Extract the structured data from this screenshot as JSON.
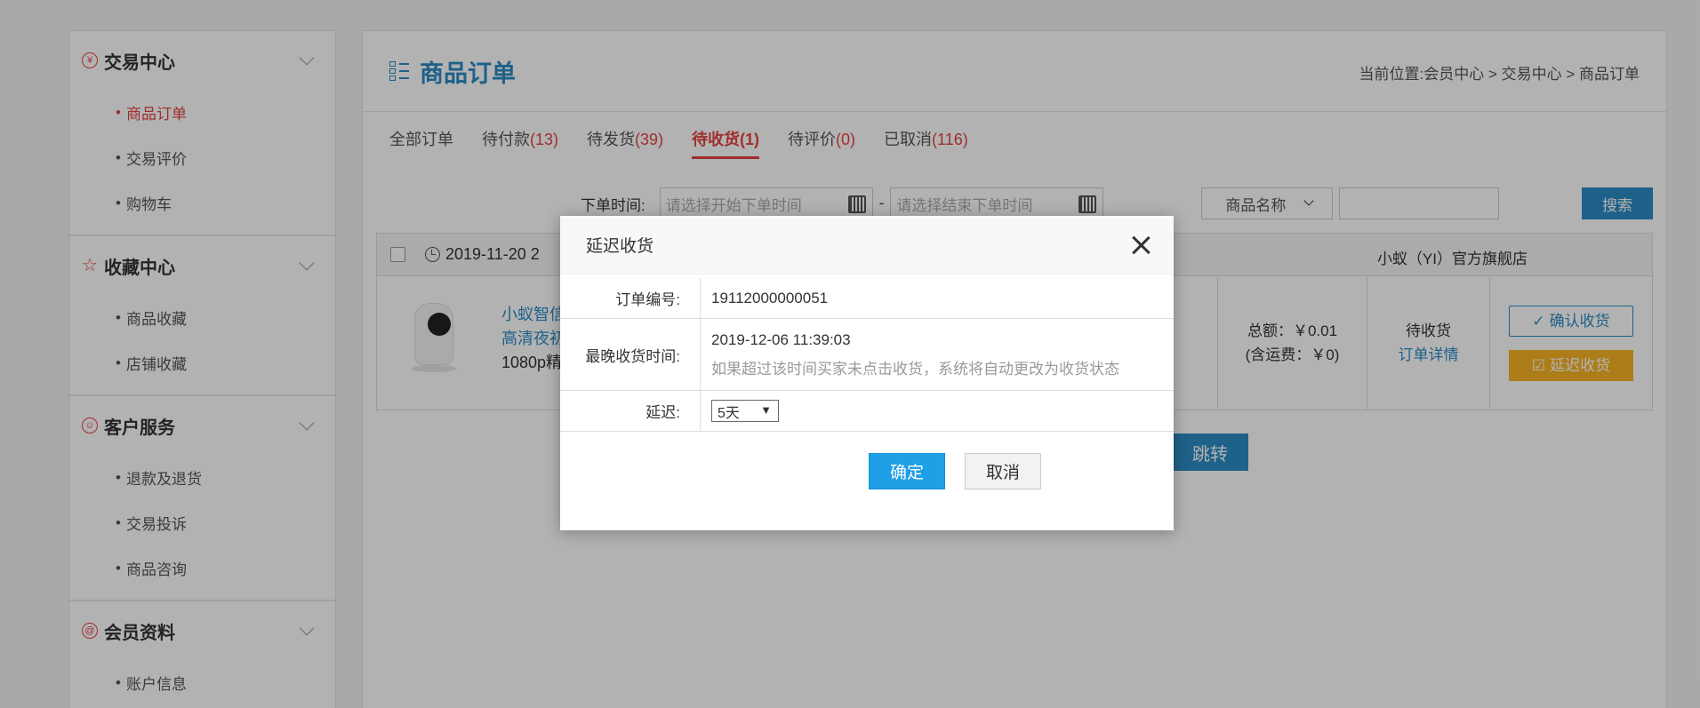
{
  "sidebar": {
    "groups": [
      {
        "title": "交易中心",
        "icon": "coin-icon",
        "items": [
          "商品订单",
          "交易评价",
          "购物车"
        ]
      },
      {
        "title": "收藏中心",
        "icon": "star-icon",
        "items": [
          "商品收藏",
          "店铺收藏"
        ]
      },
      {
        "title": "客户服务",
        "icon": "smile-icon",
        "items": [
          "退款及退货",
          "交易投诉",
          "商品咨询"
        ]
      },
      {
        "title": "会员资料",
        "icon": "at-icon",
        "items": [
          "账户信息"
        ]
      }
    ],
    "dot": "•"
  },
  "header": {
    "title": "商品订单",
    "breadcrumb": "当前位置:会员中心 > 交易中心 > 商品订单"
  },
  "tabs": [
    {
      "label": "全部订单",
      "count": ""
    },
    {
      "label": "待付款",
      "count": "(13)"
    },
    {
      "label": "待发货",
      "count": "(39)"
    },
    {
      "label": "待收货",
      "count": "(1)"
    },
    {
      "label": "待评价",
      "count": "(0)"
    },
    {
      "label": "已取消",
      "count": "(116)"
    }
  ],
  "filter": {
    "label": "下单时间:",
    "start_placeholder": "请选择开始下单时间",
    "end_placeholder": "请选择结束下单时间",
    "dash": "-",
    "select_value": "商品名称",
    "search_button": "搜索"
  },
  "order": {
    "date": "2019-11-20 2",
    "shop": "小蚁（YI）官方旗舰店",
    "product_line1": "小蚁智信",
    "product_line2": "高清夜初",
    "product_line3": "1080p精",
    "total": "总额：￥0.01",
    "shipping": "(含运费：￥0)",
    "status": "待收货",
    "detail_link": "订单详情",
    "confirm_button": "确认收货",
    "delay_button": "延迟收货",
    "jump_button": "跳转"
  },
  "dialog": {
    "title": "延迟收货",
    "order_no_label": "订单编号:",
    "order_no": "19112000000051",
    "deadline_label": "最晚收货时间:",
    "deadline": "2019-12-06 11:39:03",
    "hint": "如果超过该时间买家未点击收货，系统将自动更改为收货状态",
    "delay_label": "延迟:",
    "delay_value": "5天",
    "ok_button": "确定",
    "cancel_button": "取消"
  },
  "colors": {
    "accent": "#2b8cc4",
    "danger": "#e64340",
    "warning": "#f6b324"
  }
}
